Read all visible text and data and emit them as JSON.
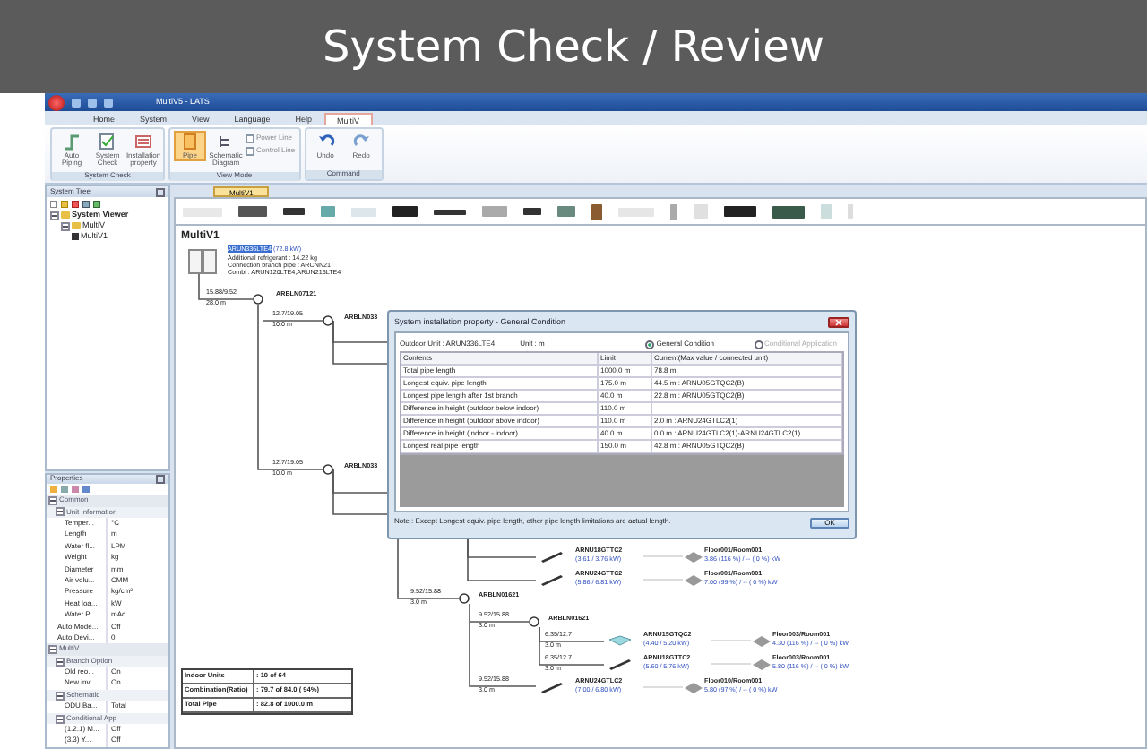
{
  "slide": {
    "title": "System Check / Review"
  },
  "app": {
    "title": "MultiV5 - LATS"
  },
  "menu_tabs": [
    {
      "label": "Home",
      "selected": false
    },
    {
      "label": "System",
      "selected": false
    },
    {
      "label": "View",
      "selected": false
    },
    {
      "label": "Language",
      "selected": false
    },
    {
      "label": "Help",
      "selected": false
    },
    {
      "label": "MultiV",
      "selected": true
    }
  ],
  "ribbon": {
    "groups": [
      {
        "label": "System Check",
        "items": [
          {
            "kind": "button",
            "label": "Auto Piping"
          },
          {
            "kind": "button",
            "label": "System Check"
          },
          {
            "kind": "button",
            "label": "Installation property"
          }
        ]
      },
      {
        "label": "View Mode",
        "items": [
          {
            "kind": "toggle",
            "label": "Pipe",
            "on": true
          },
          {
            "kind": "toggle",
            "label": "Schematic Diagram",
            "on": false
          },
          {
            "kind": "check",
            "label": "Power Line",
            "checked": false
          },
          {
            "kind": "check",
            "label": "Control Line",
            "checked": false
          }
        ]
      },
      {
        "label": "Command",
        "items": [
          {
            "kind": "button",
            "label": "Undo"
          },
          {
            "kind": "button",
            "label": "Redo"
          }
        ]
      }
    ]
  },
  "system_tree": {
    "title": "System Tree",
    "items": [
      {
        "label": "System Viewer",
        "expanded": true,
        "children": [
          {
            "label": "MultiV",
            "expanded": true,
            "children": [
              {
                "label": "MultiV1"
              }
            ]
          }
        ]
      }
    ]
  },
  "properties": {
    "title": "Properties",
    "items": [
      {
        "kind": "category",
        "label": "Common",
        "expanded": true,
        "children": [
          {
            "kind": "group",
            "label": "Unit Information",
            "expanded": true,
            "children": [
              {
                "kind": "property",
                "label": "Temper...",
                "value": "°C"
              },
              {
                "kind": "property",
                "label": "Length",
                "value": "m"
              },
              {
                "kind": "property",
                "label": "Water fl...",
                "value": "LPM"
              },
              {
                "kind": "property",
                "label": "Weight",
                "value": "kg"
              },
              {
                "kind": "property",
                "label": "Diameter",
                "value": "mm"
              },
              {
                "kind": "property",
                "label": "Air volu...",
                "value": "CMM"
              },
              {
                "kind": "property",
                "label": "Pressure",
                "value": "kg/cm²"
              },
              {
                "kind": "property",
                "label": "Heat loa...",
                "value": "kW"
              },
              {
                "kind": "property",
                "label": "Water P...",
                "value": "mAq"
              }
            ]
          },
          {
            "kind": "property",
            "label": "Auto Mode...",
            "value": "Off"
          },
          {
            "kind": "property",
            "label": "Auto Devi...",
            "value": "0"
          }
        ]
      },
      {
        "kind": "category",
        "label": "MultiV",
        "expanded": true,
        "children": [
          {
            "kind": "group",
            "label": "Branch Option",
            "expanded": true,
            "children": [
              {
                "kind": "property",
                "label": "Old reo...",
                "value": "On"
              },
              {
                "kind": "property",
                "label": "New inv...",
                "value": "On"
              }
            ]
          },
          {
            "kind": "group",
            "label": "Schematic",
            "expanded": true,
            "children": [
              {
                "kind": "property",
                "label": "ODU Ba...",
                "value": "Total"
              }
            ]
          },
          {
            "kind": "group",
            "label": "Conditional App",
            "expanded": true,
            "children": [
              {
                "kind": "property",
                "label": "(1.2.1) M...",
                "value": "Off"
              },
              {
                "kind": "property",
                "label": "(3.3) Y...",
                "value": "Off"
              }
            ]
          }
        ]
      }
    ]
  },
  "doc_tabs": [
    {
      "label": "MultiV1",
      "selected": true
    }
  ],
  "canvas": {
    "heading": "MultiV1",
    "outdoor": {
      "model": "ARUN336LTE4",
      "capacity": "(72.8 kW)",
      "lines": [
        "Additional refrigerant : 14.22 kg",
        "Connection branch pipe : ARCNN21",
        "Combi : ARUN120LTE4,ARUN216LTE4"
      ]
    },
    "branches": [
      "ARBLN07121",
      "ARBLN033",
      "ARBLN033",
      "ARBLN01621",
      "ARBLN01621"
    ],
    "pipes": [
      {
        "size": "15.88/9.52",
        "length": "28.0 m"
      },
      {
        "size": "12.7/19.05",
        "length": "10.0 m"
      },
      {
        "size": "12.7/19.05",
        "length": "10.0 m"
      },
      {
        "size": "9.52/15.88",
        "length": "3.0 m"
      },
      {
        "size": "9.52/15.88",
        "length": "3.0 m"
      },
      {
        "size": "6.35/12.7",
        "length": "3.0 m"
      },
      {
        "size": "6.35/12.7",
        "length": "3.0 m"
      },
      {
        "size": "9.52/15.88",
        "length": "3.0 m"
      }
    ],
    "units": [
      {
        "kind": "slim",
        "model": "ARNU18GTTC2",
        "capacity": "(3.61 / 3.76 kW)",
        "room": "Floor001/Room001",
        "ratio": "3.86 (116 %) / -- ( 0 %) kW"
      },
      {
        "kind": "slim",
        "model": "ARNU24GTTC2",
        "capacity": "(5.86 / 6.81 kW)",
        "room": "Floor001/Room001",
        "ratio": "7.00 (99 %) / -- ( 0 %) kW"
      },
      {
        "kind": "cassette",
        "model": "ARNU15GTQC2",
        "capacity": "(4.40 / 5.20 kW)",
        "room": "Floor003/Room001",
        "ratio": "4.30 (116 %) / -- ( 0 %) kW"
      },
      {
        "kind": "slim",
        "model": "ARNU18GTTC2",
        "capacity": "(5.60 / 5.76 kW)",
        "room": "Floor003/Room001",
        "ratio": "5.80 (116 %) / -- ( 0 %) kW"
      },
      {
        "kind": "slim",
        "model": "ARNU24GTLC2",
        "capacity": "(7.00 / 6.80 kW)",
        "room": "Floor010/Room001",
        "ratio": "5.80 (97 %) / -- ( 0 %) kW"
      }
    ],
    "summary": [
      {
        "label": "Indoor Units",
        "value": ": 10 of 64"
      },
      {
        "label": "Combination(Ratio)",
        "value": ": 79.7 of 84.0 ( 94%)"
      },
      {
        "label": "Total Pipe",
        "value": ": 82.8 of 1000.0 m"
      }
    ]
  },
  "dialog": {
    "title": "System installation property - General Condition",
    "outdoor": "Outdoor Unit : ARUN336LTE4",
    "unit": "Unit : m",
    "options": [
      {
        "label": "General Condition",
        "selected": true,
        "disabled": false
      },
      {
        "label": "Conditional Application",
        "selected": false,
        "disabled": true
      }
    ],
    "columns": [
      "Contents",
      "Limit",
      "Current(Max value / connected unit)"
    ],
    "rows": [
      [
        "Total pipe length",
        "1000.0 m",
        "78.8 m"
      ],
      [
        "Longest equiv. pipe length",
        "175.0 m",
        "44.5 m : ARNU05GTQC2(B)"
      ],
      [
        "Longest pipe length after 1st branch",
        "40.0 m",
        "22.8 m : ARNU05GTQC2(B)"
      ],
      [
        "Difference in height (outdoor below indoor)",
        "110.0 m",
        null
      ],
      [
        "Difference in height (outdoor above indoor)",
        "110.0 m",
        "2.0 m : ARNU24GTLC2(1)"
      ],
      [
        "Difference in height (indoor - indoor)",
        "40.0 m",
        "0.0 m : ARNU24GTLC2(1)-ARNU24GTLC2(1)"
      ],
      [
        "Longest real pipe length",
        "150.0 m",
        "42.8 m : ARNU05GTQC2(B)"
      ]
    ],
    "note": "Note : Except Longest equiv. pipe length, other pipe length limitations are actual length.",
    "ok": "OK"
  }
}
